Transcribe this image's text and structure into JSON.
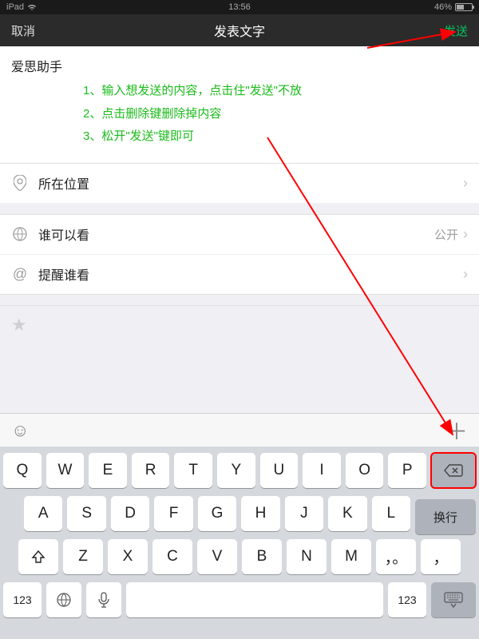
{
  "status": {
    "device": "iPad",
    "time": "13:56",
    "battery_pct": "46%"
  },
  "nav": {
    "cancel": "取消",
    "title": "发表文字",
    "send": "发送"
  },
  "compose": {
    "text": "爱思助手",
    "instructions": [
      "1、输入想发送的内容，点击住\"发送\"不放",
      "2、点击删除键删除掉内容",
      "3、松开\"发送\"键即可"
    ]
  },
  "rows": {
    "location": {
      "label": "所在位置"
    },
    "visibility": {
      "label": "谁可以看",
      "value": "公开"
    },
    "mention": {
      "label": "提醒谁看"
    }
  },
  "keyboard": {
    "row1": [
      "Q",
      "W",
      "E",
      "R",
      "T",
      "Y",
      "U",
      "I",
      "O",
      "P"
    ],
    "row2": [
      "A",
      "S",
      "D",
      "F",
      "G",
      "H",
      "J",
      "K",
      "L"
    ],
    "row3": [
      "Z",
      "X",
      "C",
      "V",
      "B",
      "N",
      "M"
    ],
    "ret": "换行",
    "punct": "，。",
    "comma": "，",
    "num": "123"
  }
}
